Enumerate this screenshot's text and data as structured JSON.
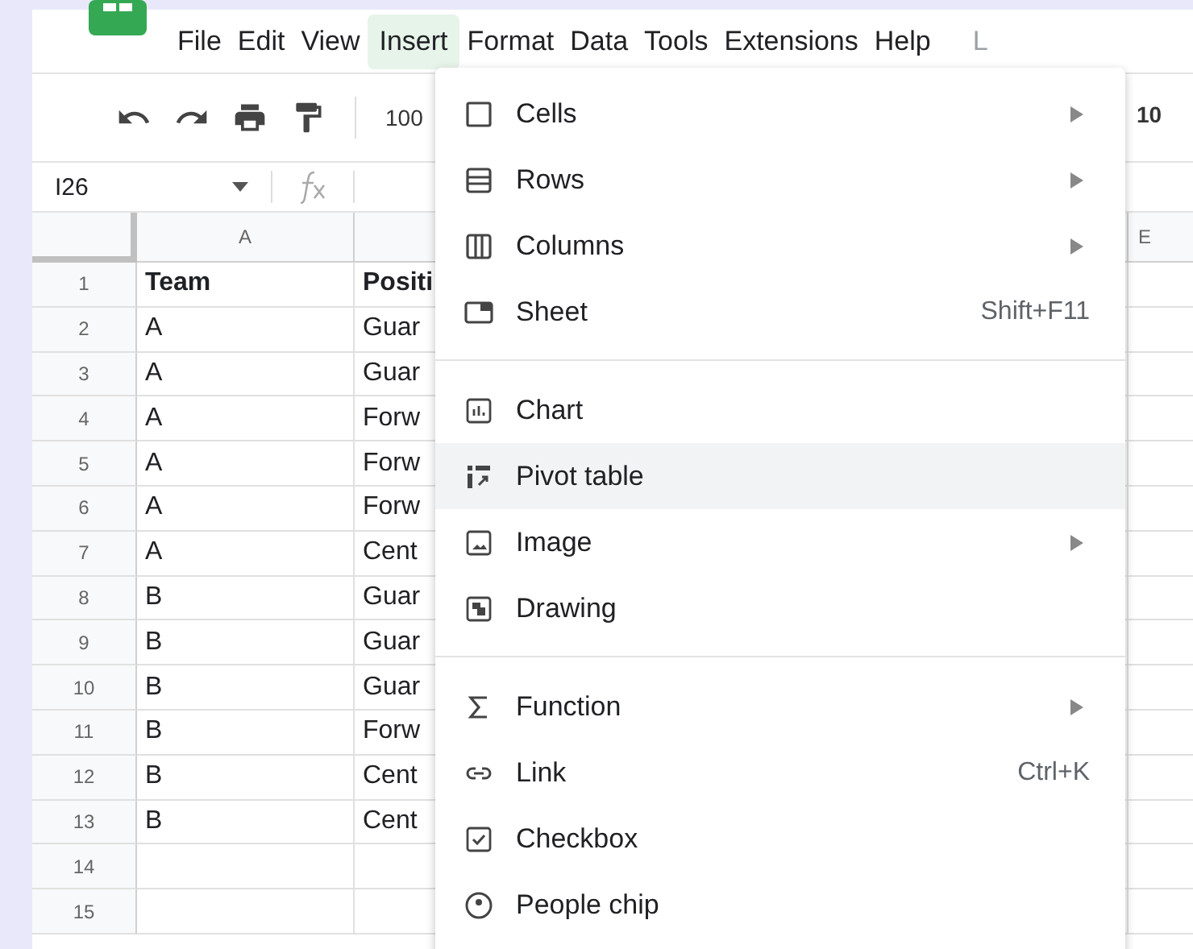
{
  "menu_bar": [
    {
      "label": "File",
      "selected": false
    },
    {
      "label": "Edit",
      "selected": false
    },
    {
      "label": "View",
      "selected": false
    },
    {
      "label": "Insert",
      "selected": true
    },
    {
      "label": "Format",
      "selected": false
    },
    {
      "label": "Data",
      "selected": false
    },
    {
      "label": "Tools",
      "selected": false
    },
    {
      "label": "Extensions",
      "selected": false
    },
    {
      "label": "Help",
      "selected": false
    },
    {
      "label": "L",
      "selected": false
    }
  ],
  "toolbar": {
    "zoom": "100",
    "font_size": "10"
  },
  "formula_bar": {
    "cell_reference": "I26"
  },
  "sheet": {
    "column_headers": [
      "A",
      "E"
    ],
    "rows": [
      {
        "number": "1",
        "cells": [
          "Team",
          "Positi"
        ],
        "header": true
      },
      {
        "number": "2",
        "cells": [
          "A",
          "Guar"
        ],
        "header": false
      },
      {
        "number": "3",
        "cells": [
          "A",
          "Guar"
        ],
        "header": false
      },
      {
        "number": "4",
        "cells": [
          "A",
          "Forw"
        ],
        "header": false
      },
      {
        "number": "5",
        "cells": [
          "A",
          "Forw"
        ],
        "header": false
      },
      {
        "number": "6",
        "cells": [
          "A",
          "Forw"
        ],
        "header": false
      },
      {
        "number": "7",
        "cells": [
          "A",
          "Cent"
        ],
        "header": false
      },
      {
        "number": "8",
        "cells": [
          "B",
          "Guar"
        ],
        "header": false
      },
      {
        "number": "9",
        "cells": [
          "B",
          "Guar"
        ],
        "header": false
      },
      {
        "number": "10",
        "cells": [
          "B",
          "Guar"
        ],
        "header": false
      },
      {
        "number": "11",
        "cells": [
          "B",
          "Forw"
        ],
        "header": false
      },
      {
        "number": "12",
        "cells": [
          "B",
          "Cent"
        ],
        "header": false
      },
      {
        "number": "13",
        "cells": [
          "B",
          "Cent"
        ],
        "header": false
      },
      {
        "number": "14",
        "cells": []
      },
      {
        "number": "15",
        "cells": []
      }
    ]
  },
  "insert_menu": {
    "groups": [
      [
        {
          "label": "Cells",
          "submenu": true,
          "selected": false
        },
        {
          "label": "Rows",
          "submenu": true,
          "selected": false
        },
        {
          "label": "Columns",
          "submenu": true,
          "selected": false
        },
        {
          "label": "Sheet",
          "shortcut": "Shift+F11",
          "selected": false
        }
      ],
      [
        {
          "label": "Chart",
          "selected": false
        },
        {
          "label": "Pivot table",
          "selected": true
        },
        {
          "label": "Image",
          "submenu": true,
          "selected": false
        },
        {
          "label": "Drawing",
          "selected": false
        }
      ],
      [
        {
          "label": "Function",
          "submenu": true,
          "selected": false
        },
        {
          "label": "Link",
          "shortcut": "Ctrl+K",
          "selected": false
        },
        {
          "label": "Checkbox",
          "selected": false
        },
        {
          "label": "People chip",
          "selected": false
        }
      ]
    ]
  }
}
